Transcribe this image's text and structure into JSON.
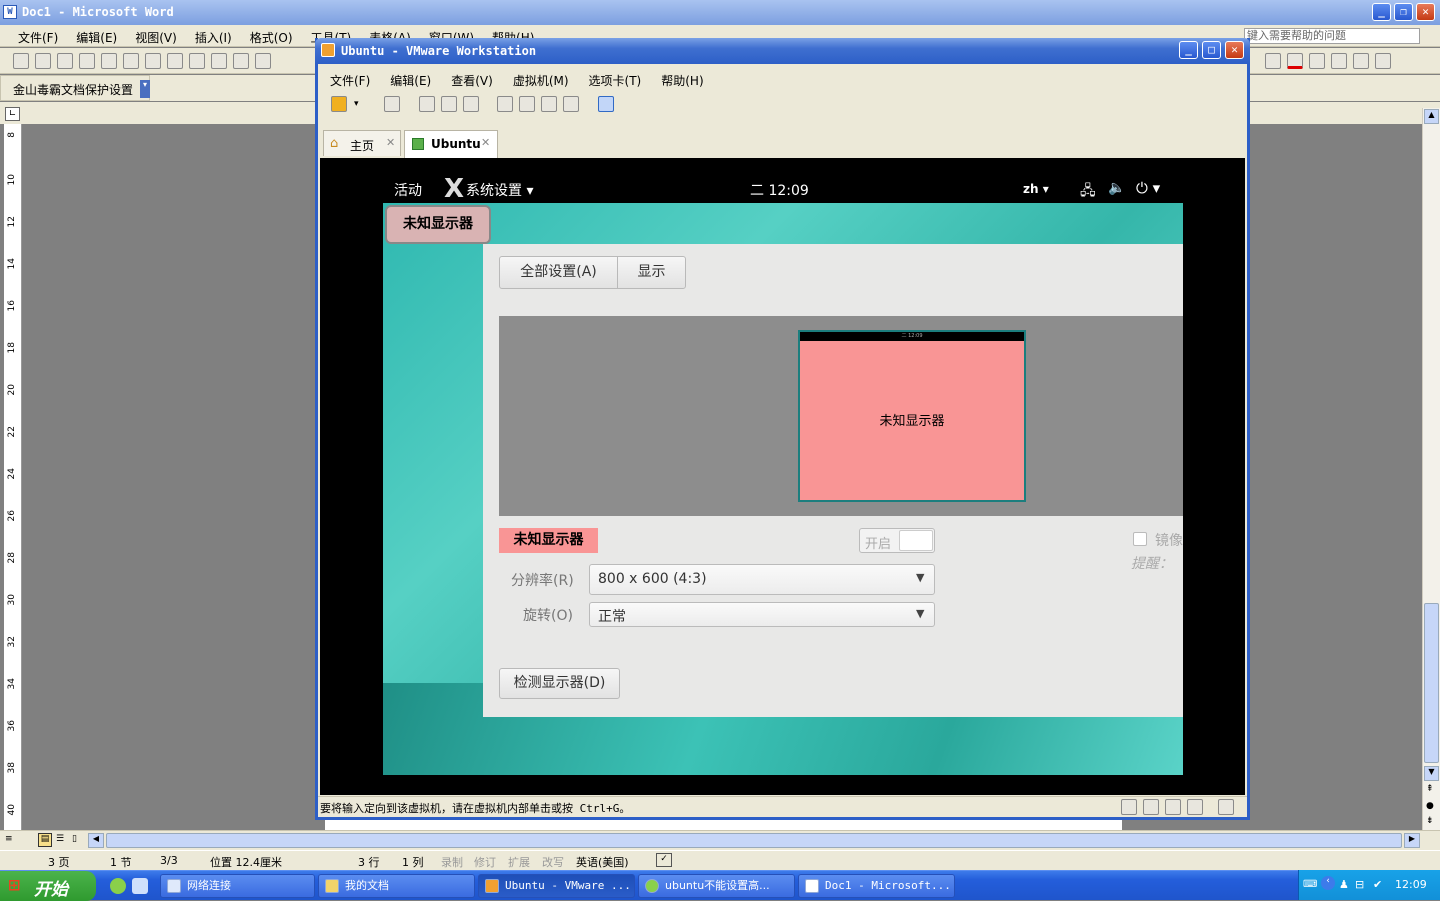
{
  "word": {
    "title": "Doc1 - Microsoft Word",
    "menu": [
      "文件(F)",
      "编辑(E)",
      "视图(V)",
      "插入(I)",
      "格式(O)",
      "工具(T)",
      "表格(A)",
      "窗口(W)",
      "帮助(H)"
    ],
    "help_placeholder": "键入需要帮助的问题",
    "jinshan_toolbar": "金山毒霸文档保护设置",
    "ruler_numbers": [
      "8",
      "10",
      "12",
      "14",
      "16",
      "18",
      "20",
      "22",
      "24",
      "26",
      "28",
      "30",
      "32",
      "34",
      "36",
      "38",
      "40"
    ],
    "status": {
      "page": "3 页",
      "section": "1 节",
      "pages": "3/3",
      "position": "位置 12.4厘米",
      "line": "3 行",
      "column": "1 列",
      "rec": "录制",
      "trk": "修订",
      "ext": "扩展",
      "ovr": "改写",
      "language": "英语(美国)"
    }
  },
  "vmware": {
    "title": "Ubuntu - VMware Workstation",
    "menu": [
      "文件(F)",
      "编辑(E)",
      "查看(V)",
      "虚拟机(M)",
      "选项卡(T)",
      "帮助(H)"
    ],
    "tabs": [
      {
        "label": "主页",
        "icon": "home-icon"
      },
      {
        "label": "Ubuntu",
        "icon": "vm-icon"
      }
    ],
    "status_message": "要将输入定向到该虚拟机，请在虚拟机内部单击或按 Ctrl+G。"
  },
  "ubuntu": {
    "topbar": {
      "activities": "活动",
      "app_menu": "系统设置",
      "clock": "二 12:09",
      "input_method": "zh"
    },
    "overlay_label": "未知显示器",
    "breadcrumb": [
      "全部设置(A)",
      "显示"
    ],
    "monitor_preview": {
      "label": "未知显示器",
      "mini_clock": "二 12:09"
    },
    "display_name": "未知显示器",
    "switch_label": "开启",
    "resolution_label": "分辨率(R)",
    "resolution_value": "800 x 600 (4:3)",
    "rotation_label": "旋转(O)",
    "rotation_value": "正常",
    "mirror_label": "镜像",
    "hint_label": "提醒：",
    "detect_button": "检测显示器(D)"
  },
  "taskbar": {
    "start": "开始",
    "items": [
      {
        "label": "网络连接"
      },
      {
        "label": "我的文档"
      },
      {
        "label": "Ubuntu - VMware ..."
      },
      {
        "label": "ubuntu不能设置高..."
      },
      {
        "label": "Doc1 - Microsoft..."
      }
    ],
    "clock": "12:09"
  },
  "colors": {
    "xp_blue": "#2d5fc7",
    "teal": "#3fc0b8",
    "monitor_pink": "#f99595",
    "display_badge": "#f99595"
  }
}
